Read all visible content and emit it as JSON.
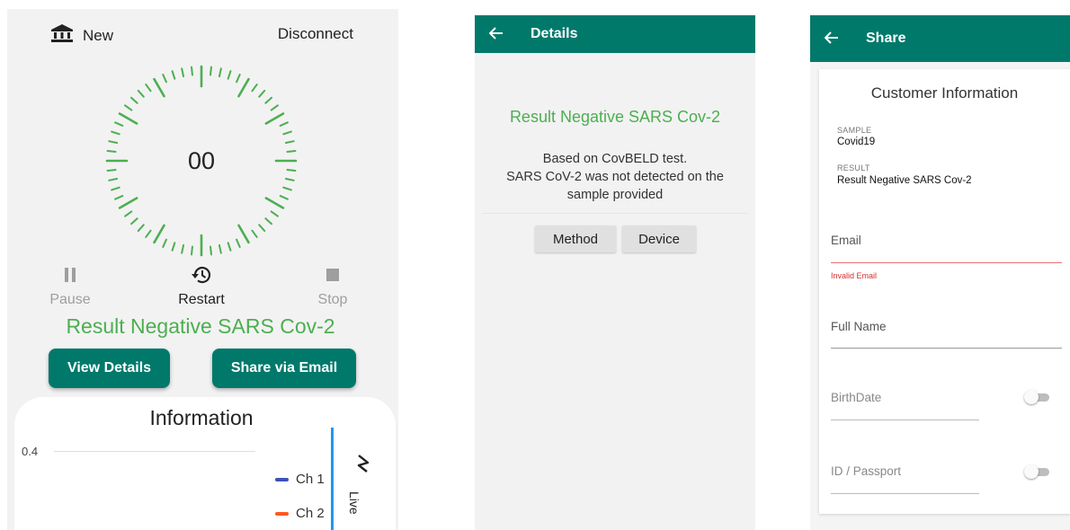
{
  "colors": {
    "accent": "#00796b",
    "success": "#4caf50",
    "error": "#d32f2f",
    "ch1": "#3f51b5",
    "ch2": "#ff5722",
    "live_line": "#2196f3"
  },
  "main": {
    "new_label": "New",
    "new_icon": "bank-icon",
    "disconnect_label": "Disconnect",
    "timer_value": "00",
    "controls": [
      {
        "label": "Pause",
        "icon": "pause-icon"
      },
      {
        "label": "Restart",
        "icon": "history-icon"
      },
      {
        "label": "Stop",
        "icon": "stop-icon"
      }
    ],
    "result": "Result Negative SARS Cov-2",
    "view_details_label": "View Details",
    "share_email_label": "Share via Email",
    "info": {
      "title": "Information",
      "y_tick": "0.4",
      "legend": [
        "Ch 1",
        "Ch 2"
      ],
      "live_label": "Live",
      "live_icon": "live-chart-icon"
    }
  },
  "details": {
    "title": "Details",
    "back_icon": "arrow-left-icon",
    "result": "Result Negative SARS Cov-2",
    "description": [
      "Based on CovBELD test.",
      "SARS CoV-2 was not detected on the",
      "sample provided"
    ],
    "method_label": "Method",
    "device_label": "Device"
  },
  "share": {
    "title": "Share",
    "back_icon": "arrow-left-icon",
    "customer_title": "Customer Information",
    "sample_label": "SAMPLE",
    "sample_value": "Covid19",
    "result_label": "RESULT",
    "result_value": "Result Negative SARS Cov-2",
    "email_label": "Email",
    "email_error": "Invalid Email",
    "fullname_label": "Full Name",
    "birthdate_label": "BirthDate",
    "id_label": "ID / Passport",
    "birthdate_toggle": false,
    "id_toggle": false
  }
}
